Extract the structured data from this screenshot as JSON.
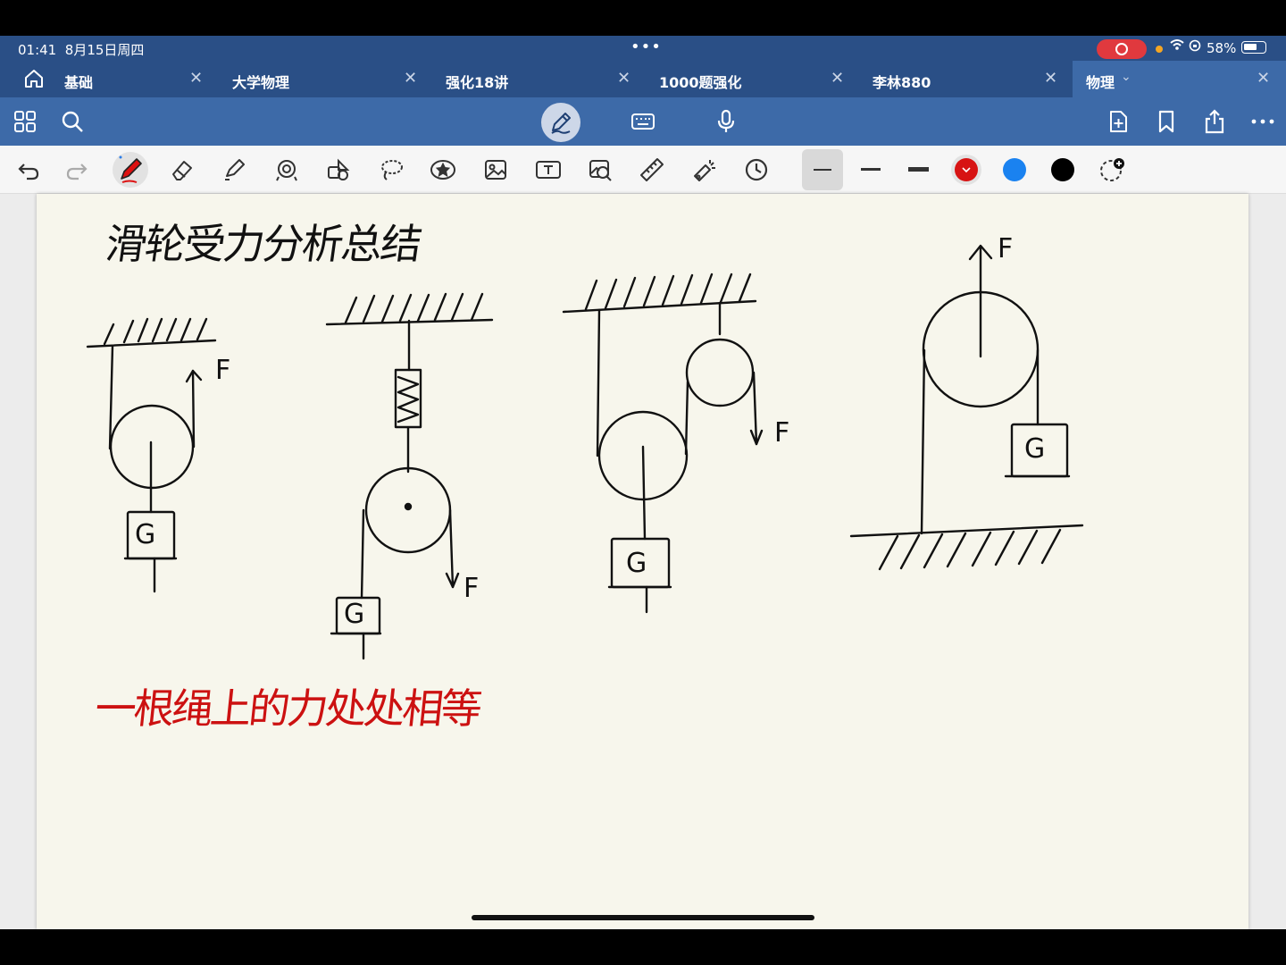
{
  "status": {
    "time": "01:41",
    "date": "8月15日周四",
    "battery": "58%"
  },
  "tabs": [
    {
      "label": "基础"
    },
    {
      "label": "大学物理"
    },
    {
      "label": "强化18讲"
    },
    {
      "label": "1000题强化"
    },
    {
      "label": "李林880"
    },
    {
      "label": "物理",
      "active": true
    }
  ],
  "colors": {
    "accent": "#2a4f86",
    "toolbar": "#3d6aa8",
    "ink_red": "#cc1111",
    "swatch_blue": "#1a82f0",
    "swatch_black": "#000000"
  },
  "toolbar_icons": [
    "grid-icon",
    "search-icon",
    "pen-mode-icon",
    "keyboard-icon",
    "microphone-icon",
    "add-page-icon",
    "bookmark-icon",
    "share-icon",
    "more-icon"
  ],
  "drawing_tools": [
    "undo-icon",
    "redo-icon",
    "pen-tool-icon",
    "eraser-tool-icon",
    "highlighter-tool-icon",
    "shape-tool-icon",
    "elements-tool-icon",
    "lasso-tool-icon",
    "sticker-tool-icon",
    "image-tool-icon",
    "textbox-tool-icon",
    "camera-tool-icon",
    "ruler-tool-icon",
    "laser-tool-icon",
    "history-icon"
  ],
  "note": {
    "title": "滑轮受力分析总结",
    "conclusion": "一根绳上的力处处相等",
    "labels": {
      "force": "F",
      "weight": "G"
    }
  }
}
